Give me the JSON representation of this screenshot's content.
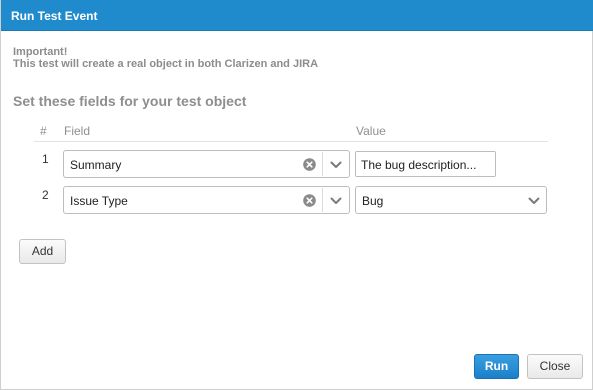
{
  "dialog": {
    "title": "Run Test Event"
  },
  "notice": {
    "heading": "Important!",
    "body": "This test will create a real object in both Clarizen and JIRA"
  },
  "section_title": "Set these fields for your test object",
  "table": {
    "columns": [
      "#",
      "Field",
      "Value"
    ],
    "rows": [
      {
        "num": "1",
        "field": "Summary",
        "value": "The bug description..."
      },
      {
        "num": "2",
        "field": "Issue Type",
        "value": "Bug"
      }
    ]
  },
  "buttons": {
    "add": "Add",
    "run": "Run",
    "close": "Close"
  },
  "icons": {
    "clear": "clear-icon",
    "dropdown": "chevron-down-icon"
  },
  "colors": {
    "titlebar": "#1f8bcd",
    "primary_button": "#1b80c8"
  }
}
